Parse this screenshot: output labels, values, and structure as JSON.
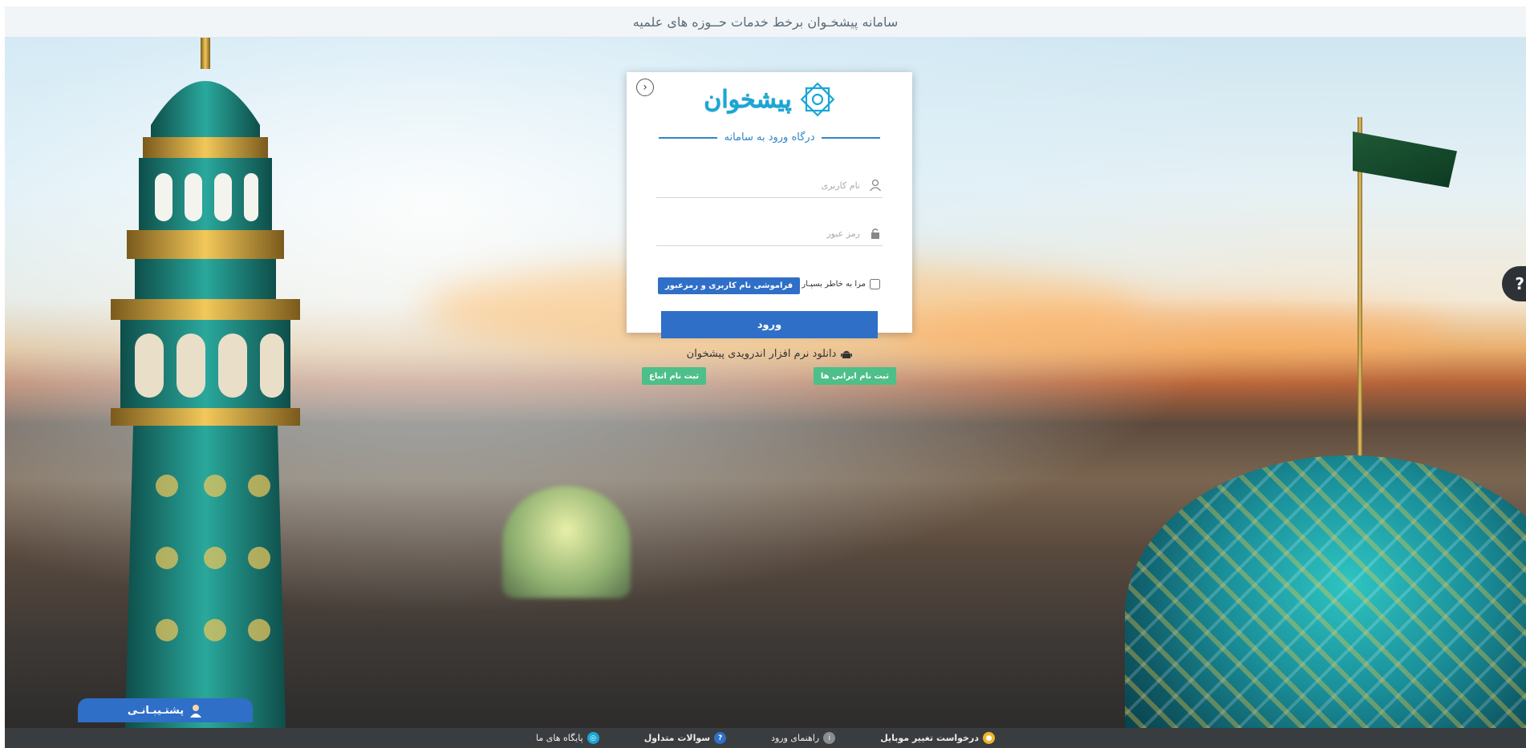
{
  "topbar": {
    "title": "سامانه پیشخـوان برخط خدمات حــوزه های علمیه"
  },
  "login": {
    "back_icon": "chevron-right-icon",
    "logo_text": "پیشخوان",
    "section_title": "درگاه ورود به سامانه",
    "username": {
      "placeholder": "نام کاربری",
      "value": ""
    },
    "password": {
      "placeholder": "رمز عبور",
      "value": ""
    },
    "remember_label": "مرا به خاطر بسپـار",
    "forgot_label": "فراموشی نام کاربری و رمزعبور",
    "submit_label": "ورود",
    "android_label": "دانلود نرم افزار اندرویدی پیشخوان",
    "register_iranian_label": "ثبت نام ایرانی ها",
    "register_foreign_label": "ثبت نام اتباع"
  },
  "help_tab": {
    "label": "?"
  },
  "support": {
    "label": "پشتـیبـانـی"
  },
  "footer": {
    "items": [
      {
        "label": "درخواست تغییر موبایل",
        "icon": "user-icon",
        "color": "#f0b429"
      },
      {
        "label": "راهنمای ورود",
        "icon": "info-icon",
        "color": "#8a8d90"
      },
      {
        "label": "سوالات متداول",
        "icon": "question-users-icon",
        "color": "#2f6fc7"
      },
      {
        "label": "پایگاه های ما",
        "icon": "globe-icon",
        "color": "#1aa6d6"
      }
    ]
  },
  "colors": {
    "primary": "#2f6fc7",
    "success": "#4dbf88",
    "footer_bg": "#3a3d40"
  }
}
